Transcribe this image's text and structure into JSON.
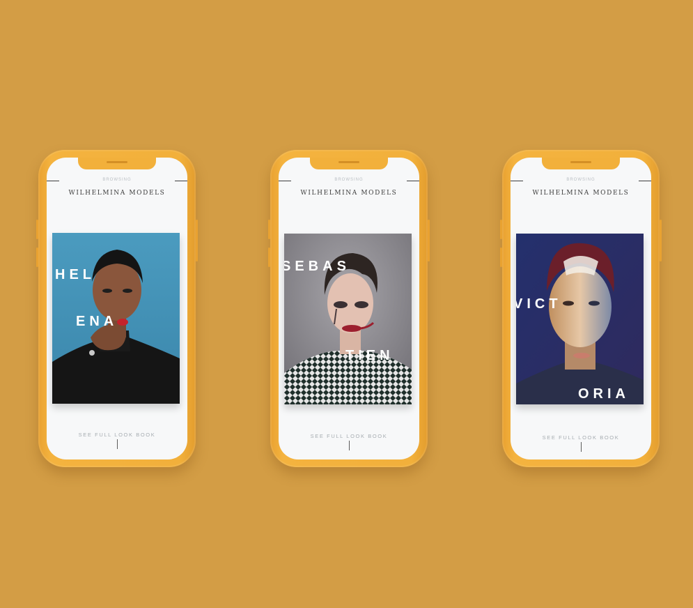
{
  "phones": [
    {
      "browsing": "BROWSING",
      "brand": "WILHELMINA MODELS",
      "name_parts": [
        "HEL",
        "ENA"
      ],
      "cta": "SEE FULL LOOK BOOK"
    },
    {
      "browsing": "BROWSING",
      "brand": "WILHELMINA MODELS",
      "name_parts": [
        "SEBAS",
        "TIEN"
      ],
      "cta": "SEE FULL LOOK BOOK"
    },
    {
      "browsing": "BROWSING",
      "brand": "WILHELMINA MODELS",
      "name_parts": [
        "VICT",
        "ORIA"
      ],
      "cta": "SEE FULL LOOK BOOK"
    }
  ],
  "colors": {
    "background": "#d39d45",
    "phone_case": "#f2b03b",
    "screen": "#f7f8f9",
    "name_text": "#ffffff"
  }
}
